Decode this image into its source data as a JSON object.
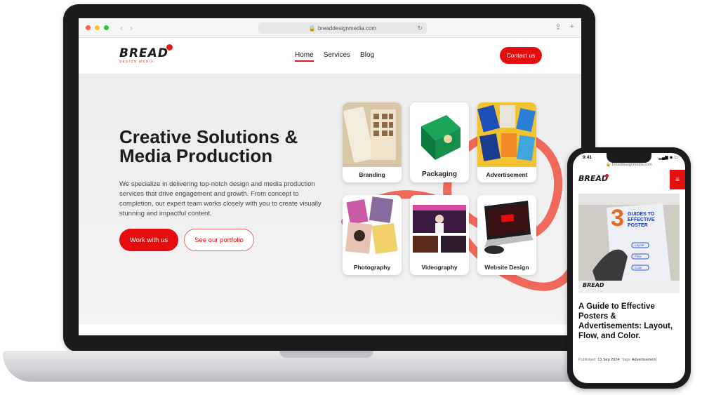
{
  "browser": {
    "url": "breaddesignmedia.com",
    "traffic_lights": [
      "#ff5f57",
      "#febc2e",
      "#28c840"
    ]
  },
  "brand": {
    "logo_text": "BREAD",
    "logo_subtext": "DESIGN MEDIA",
    "accent_color": "#e40e0e"
  },
  "nav": {
    "items": [
      {
        "label": "Home",
        "active": true
      },
      {
        "label": "Services",
        "active": false
      },
      {
        "label": "Blog",
        "active": false
      }
    ],
    "cta_label": "Contact us"
  },
  "hero": {
    "title": "Creative Solutions & Media Production",
    "description": "We specialize in delivering top-notch design and media production services that drive engagement and growth. From concept to completion, our expert team works closely with you to create visually stunning and impactful content.",
    "primary_button": "Work with us",
    "secondary_button": "See our portfolio"
  },
  "services": [
    {
      "label": "Branding",
      "icon": "branding-image"
    },
    {
      "label": "Packaging",
      "icon": "packaging-image"
    },
    {
      "label": "Advertisement",
      "icon": "advertisement-image"
    },
    {
      "label": "Photography",
      "icon": "photography-image"
    },
    {
      "label": "Videography",
      "icon": "videography-image"
    },
    {
      "label": "Website Design",
      "icon": "website-design-image"
    }
  ],
  "phone": {
    "time": "9:41",
    "url": "breaddesignmedia.com",
    "logo_text": "BREAD",
    "poster_number": "3",
    "poster_title": "GUIDES TO EFFECTIVE POSTER",
    "poster_items": [
      "Layout",
      "Flow",
      "Color"
    ],
    "article_title": "A Guide to Effective Posters & Advertisements: Layout, Flow, and Color.",
    "published_label": "Published:",
    "published_date": "13 Sep 2024",
    "tags_label": "Tags:",
    "tag": "Advertisement"
  }
}
